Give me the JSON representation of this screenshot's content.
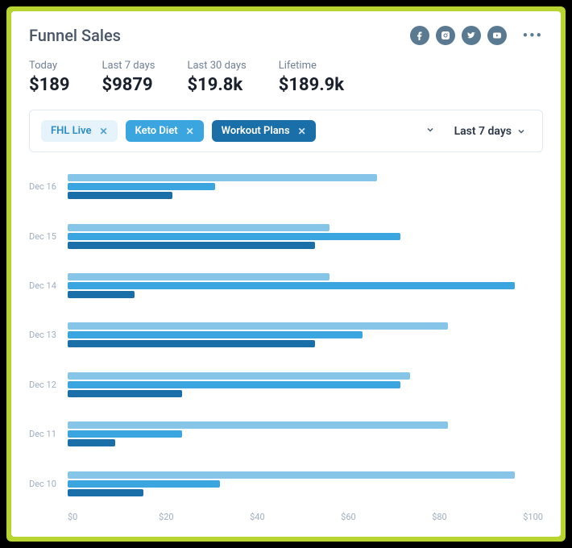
{
  "title": "Funnel Sales",
  "stats": [
    {
      "label": "Today",
      "value": "$189"
    },
    {
      "label": "Last 7 days",
      "value": "$9879"
    },
    {
      "label": "Last 30 days",
      "value": "$19.8k"
    },
    {
      "label": "Lifetime",
      "value": "$189.9k"
    }
  ],
  "chips": [
    {
      "label": "FHL Live",
      "variant": "light"
    },
    {
      "label": "Keto Diet",
      "variant": "mid"
    },
    {
      "label": "Workout Plans",
      "variant": "dark"
    }
  ],
  "range_selected": "Last 7 days",
  "chart_data": {
    "type": "bar",
    "orientation": "horizontal",
    "categories": [
      "Dec 16",
      "Dec 15",
      "Dec 14",
      "Dec 13",
      "Dec 12",
      "Dec 11",
      "Dec 10"
    ],
    "series": [
      {
        "name": "FHL Live",
        "color": "#86c5e8",
        "values": [
          65,
          55,
          55,
          80,
          72,
          80,
          94
        ]
      },
      {
        "name": "Keto Diet",
        "color": "#3aa5de",
        "values": [
          31,
          70,
          94,
          62,
          70,
          24,
          32
        ]
      },
      {
        "name": "Workout Plans",
        "color": "#1b6fa8",
        "values": [
          22,
          52,
          14,
          52,
          24,
          10,
          16
        ]
      }
    ],
    "xlabel": "",
    "ylabel": "",
    "xlim": [
      0,
      100
    ],
    "xticks": [
      "$0",
      "$20",
      "$40",
      "$60",
      "$80",
      "$100"
    ],
    "title": ""
  },
  "colors": {
    "series_a": "#86c5e8",
    "series_b": "#3aa5de",
    "series_c": "#1b6fa8"
  }
}
